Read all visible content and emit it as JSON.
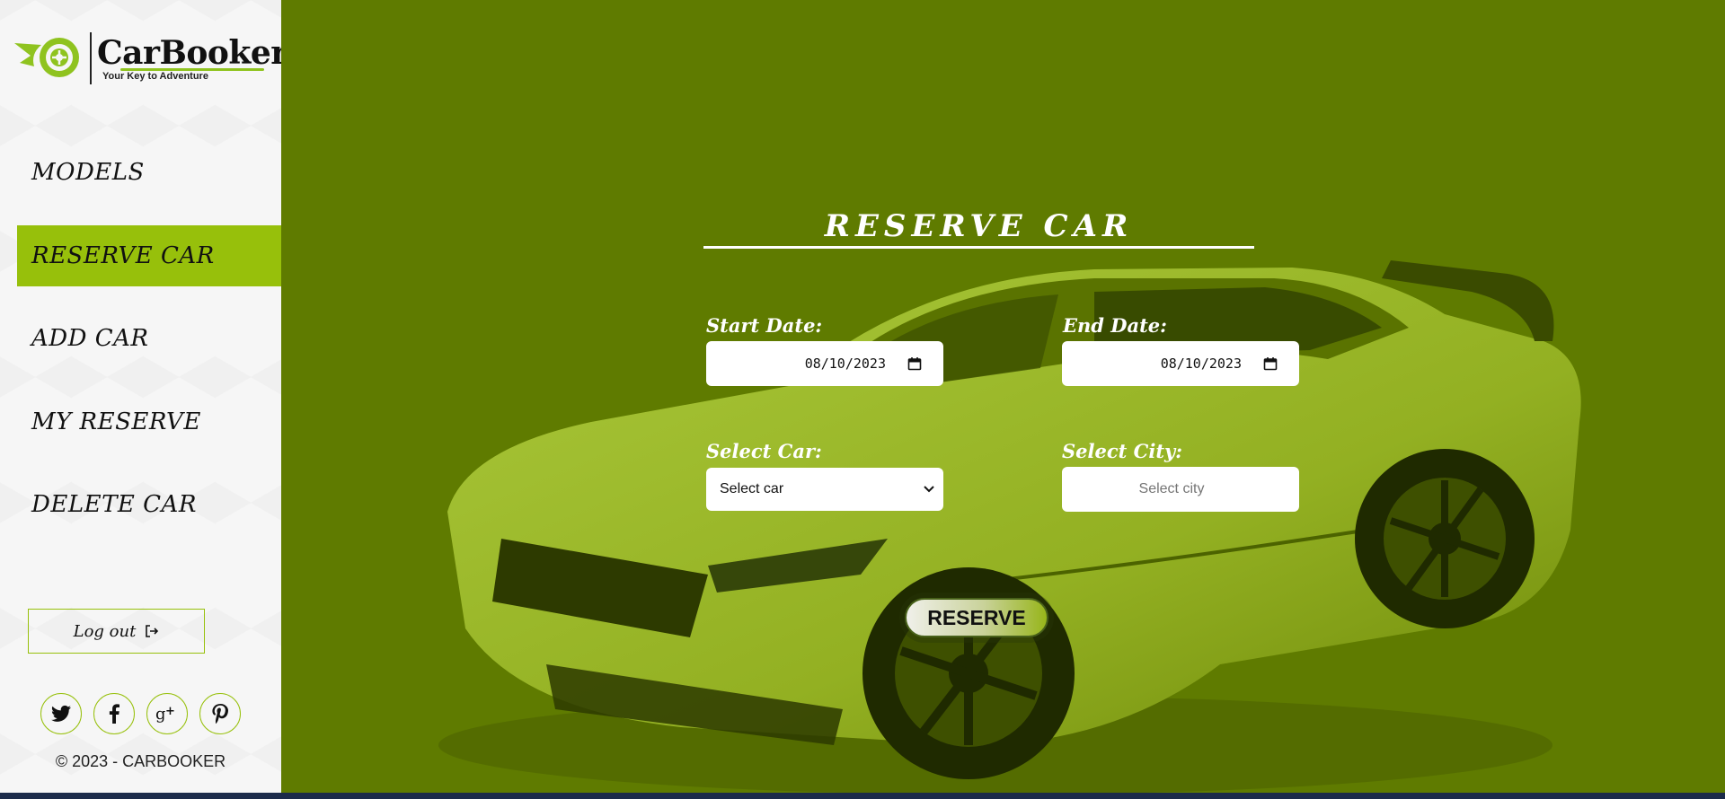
{
  "brand": {
    "name": "CarBooker",
    "tagline": "Your Key to Adventure"
  },
  "nav": {
    "items": [
      {
        "label": "MODELS",
        "active": false
      },
      {
        "label": "RESERVE CAR",
        "active": true
      },
      {
        "label": "ADD CAR",
        "active": false
      },
      {
        "label": "MY RESERVE",
        "active": false
      },
      {
        "label": "DELETE CAR",
        "active": false
      }
    ]
  },
  "logout": {
    "label": "Log out"
  },
  "socials": [
    "twitter-icon",
    "facebook-icon",
    "google-plus-icon",
    "pinterest-icon"
  ],
  "footer": {
    "copyright": "© 2023 - CARBOOKER"
  },
  "form": {
    "title": "RESERVE CAR",
    "start_date_label": "Start Date:",
    "start_date_value": "08/10/2023",
    "end_date_label": "End Date:",
    "end_date_value": "08/10/2023",
    "car_label": "Select Car:",
    "car_value": "Select car",
    "city_label": "Select City:",
    "city_placeholder": "Select city",
    "submit_label": "RESERVE"
  },
  "colors": {
    "accent": "#97c00b",
    "main_background": "#5f7b00"
  }
}
